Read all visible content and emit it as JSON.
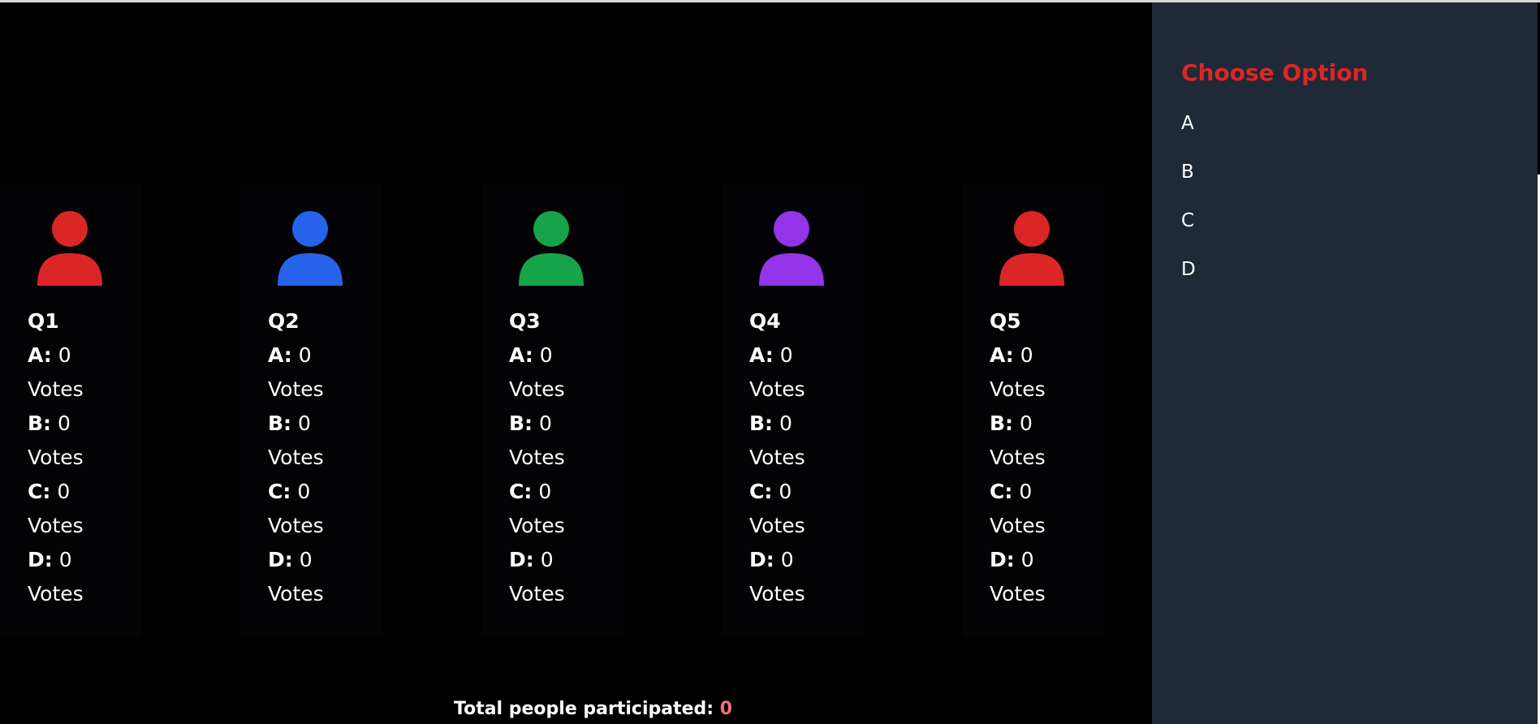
{
  "questions": [
    {
      "title": "Q1",
      "icon": "user-icon",
      "color": "#dc2626",
      "options": [
        {
          "letter": "A:",
          "count": "0",
          "unit": "Votes"
        },
        {
          "letter": "B:",
          "count": "0",
          "unit": "Votes"
        },
        {
          "letter": "C:",
          "count": "0",
          "unit": "Votes"
        },
        {
          "letter": "D:",
          "count": "0",
          "unit": "Votes"
        }
      ]
    },
    {
      "title": "Q2",
      "icon": "user-icon",
      "color": "#2563eb",
      "options": [
        {
          "letter": "A:",
          "count": "0",
          "unit": "Votes"
        },
        {
          "letter": "B:",
          "count": "0",
          "unit": "Votes"
        },
        {
          "letter": "C:",
          "count": "0",
          "unit": "Votes"
        },
        {
          "letter": "D:",
          "count": "0",
          "unit": "Votes"
        }
      ]
    },
    {
      "title": "Q3",
      "icon": "user-icon",
      "color": "#16a34a",
      "options": [
        {
          "letter": "A:",
          "count": "0",
          "unit": "Votes"
        },
        {
          "letter": "B:",
          "count": "0",
          "unit": "Votes"
        },
        {
          "letter": "C:",
          "count": "0",
          "unit": "Votes"
        },
        {
          "letter": "D:",
          "count": "0",
          "unit": "Votes"
        }
      ]
    },
    {
      "title": "Q4",
      "icon": "user-icon",
      "color": "#9333ea",
      "options": [
        {
          "letter": "A:",
          "count": "0",
          "unit": "Votes"
        },
        {
          "letter": "B:",
          "count": "0",
          "unit": "Votes"
        },
        {
          "letter": "C:",
          "count": "0",
          "unit": "Votes"
        },
        {
          "letter": "D:",
          "count": "0",
          "unit": "Votes"
        }
      ]
    },
    {
      "title": "Q5",
      "icon": "user-icon",
      "color": "#dc2626",
      "options": [
        {
          "letter": "A:",
          "count": "0",
          "unit": "Votes"
        },
        {
          "letter": "B:",
          "count": "0",
          "unit": "Votes"
        },
        {
          "letter": "C:",
          "count": "0",
          "unit": "Votes"
        },
        {
          "letter": "D:",
          "count": "0",
          "unit": "Votes"
        }
      ]
    }
  ],
  "footer": {
    "total_label": "Total people participated:",
    "total_count": "0"
  },
  "sidebar": {
    "title": "Choose Option",
    "options": [
      "A",
      "B",
      "C",
      "D"
    ]
  },
  "colors": {
    "accent": "#dc2626",
    "sidebar_bg": "#1f2937",
    "main_bg": "#000000"
  }
}
